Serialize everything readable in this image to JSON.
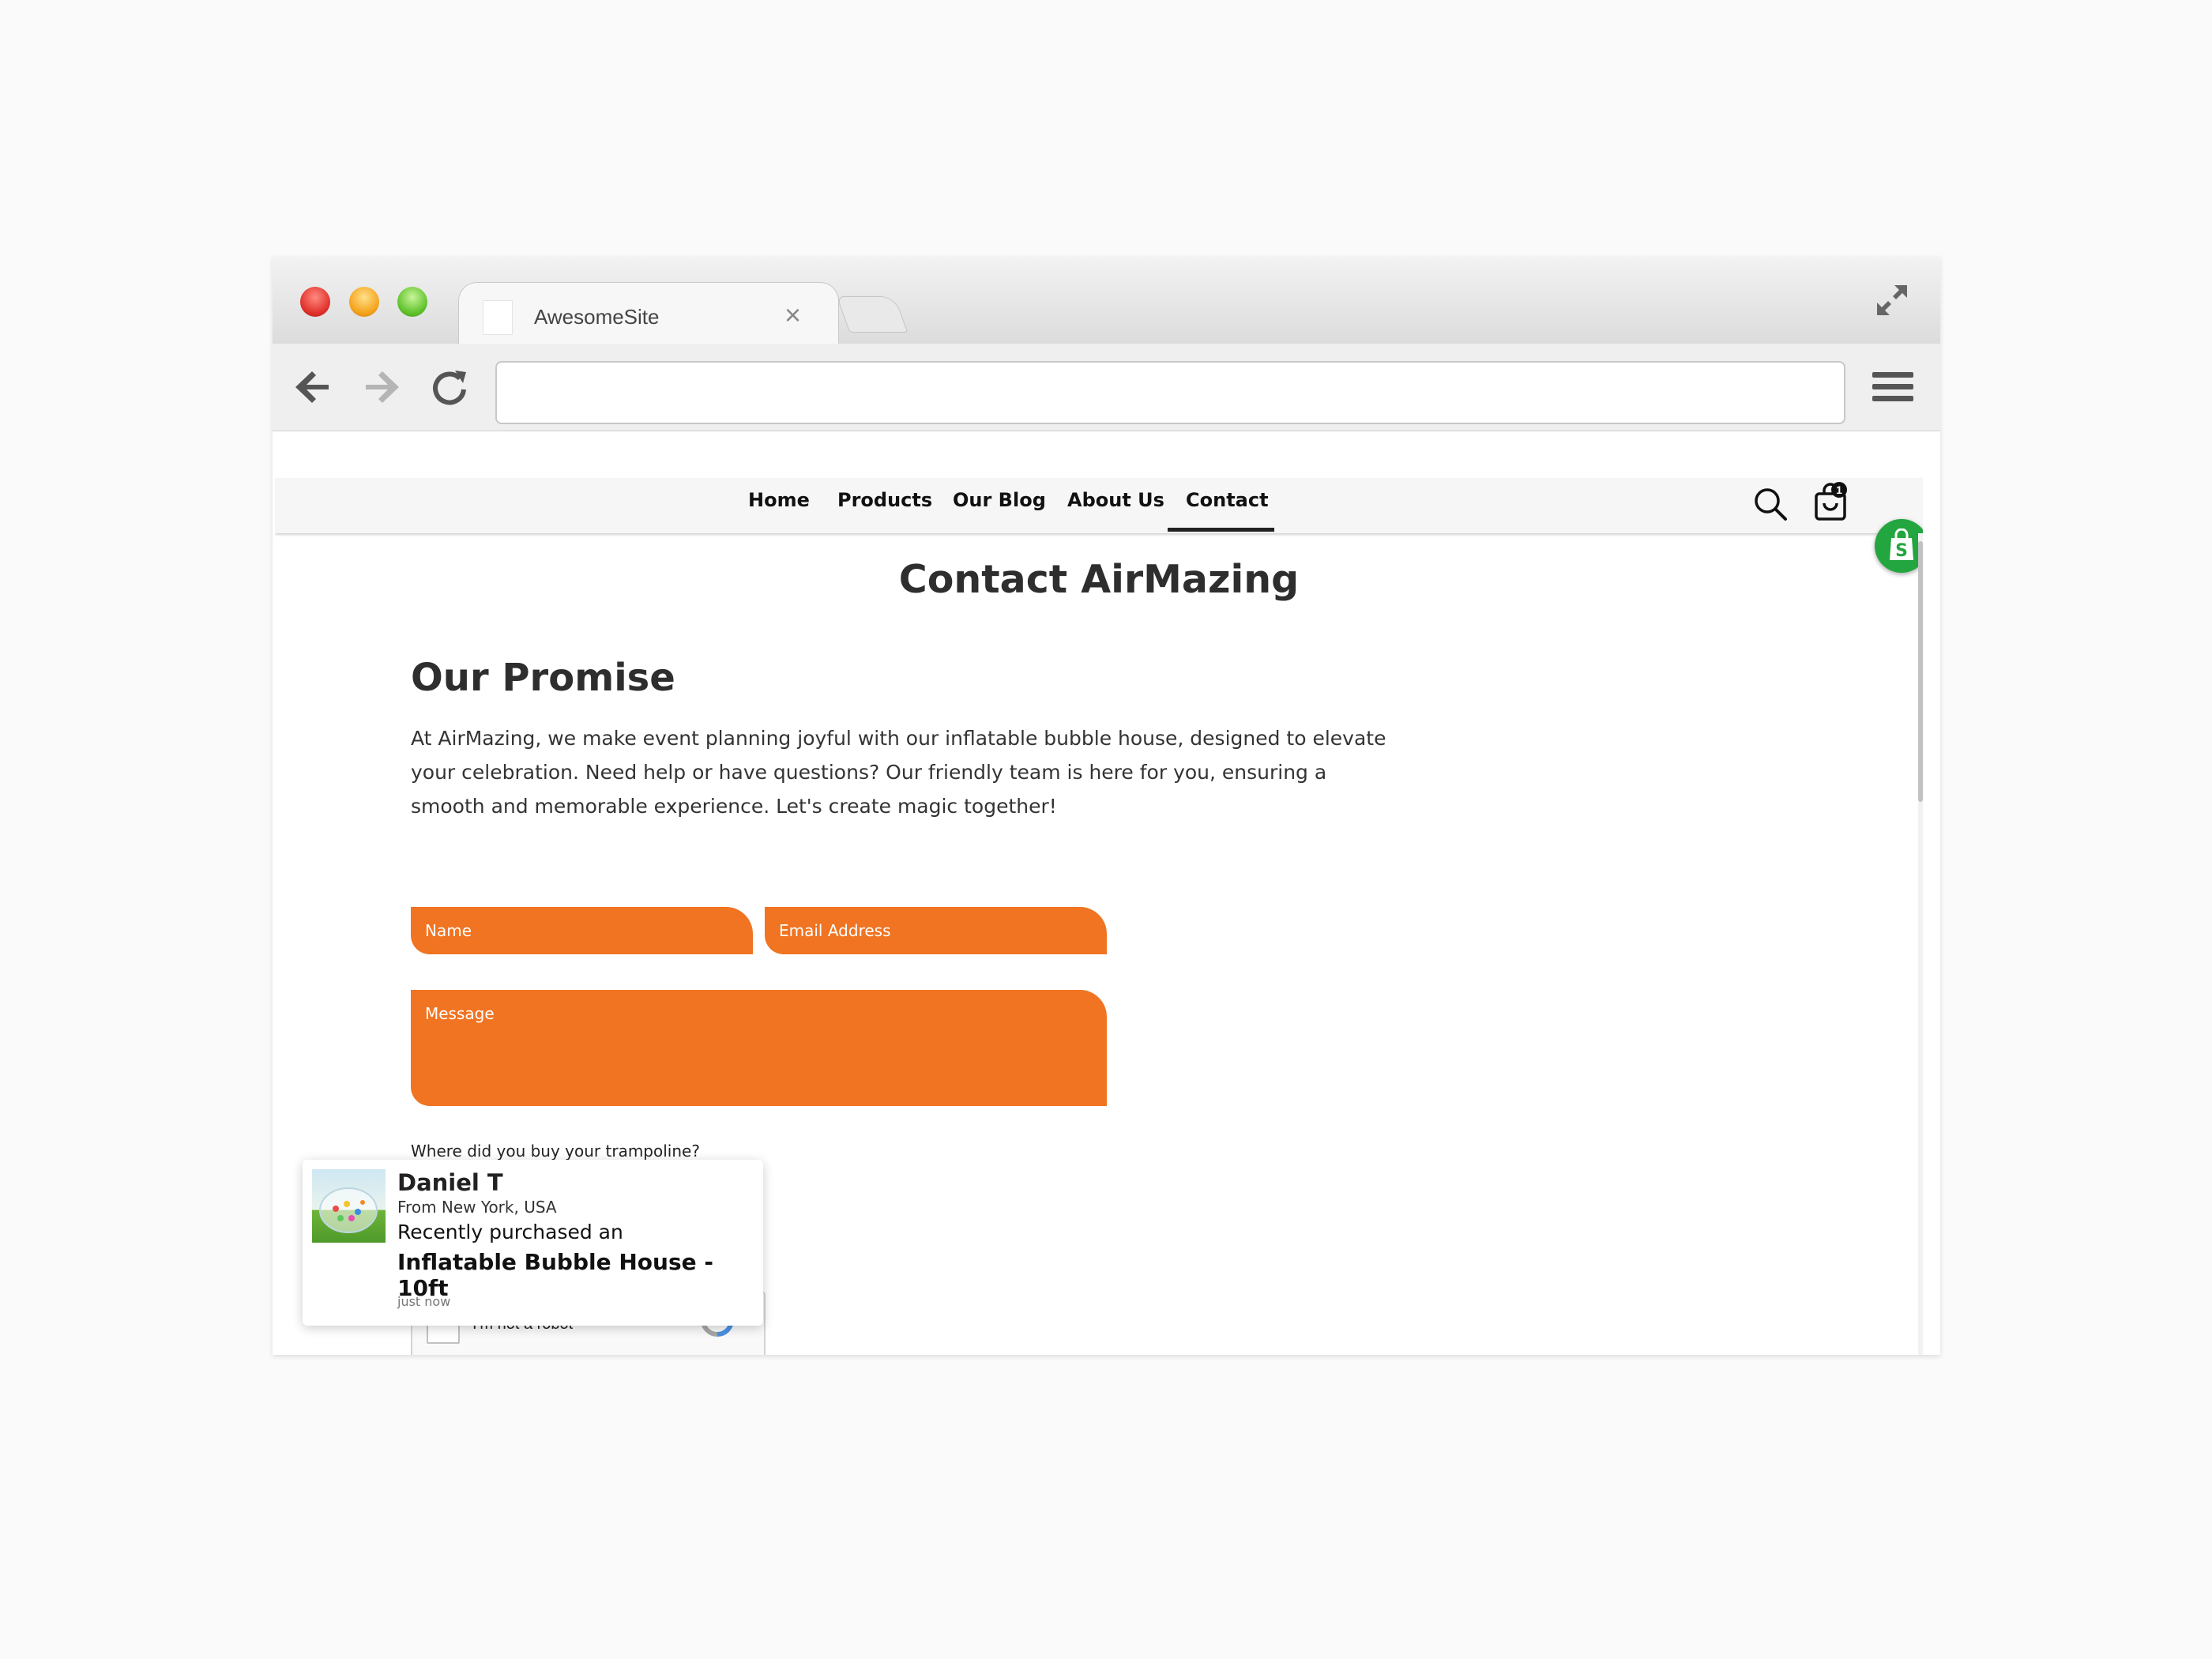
{
  "browser": {
    "tab_title": "AwesomeSite",
    "tab_close": "×",
    "address_value": ""
  },
  "site_nav": {
    "items": [
      {
        "label": "Home"
      },
      {
        "label": "Products"
      },
      {
        "label": "Our Blog"
      },
      {
        "label": "About Us"
      },
      {
        "label": "Contact"
      }
    ],
    "active": "Contact",
    "cart_count": "1"
  },
  "page": {
    "title": "Contact AirMazing",
    "section_title": "Our Promise",
    "promise_text": "At AirMazing, we make event planning joyful with our inflatable bubble house, designed to elevate your celebration. Need help or have questions? Our friendly team is here for you, ensuring a smooth and memorable experience. Let's create magic together!"
  },
  "form": {
    "name_placeholder": "Name",
    "email_placeholder": "Email Address",
    "message_placeholder": "Message",
    "question_label": "Where did you buy your trampoline?",
    "recaptcha_label": "I'm not a robot",
    "accent_color": "#f07422"
  },
  "notification": {
    "name": "Daniel T",
    "from": "From New York, USA",
    "recent": "Recently purchased an",
    "product": "Inflatable Bubble House - 10ft",
    "time": "just now"
  },
  "icons": [
    "expand-icon",
    "back-arrow-icon",
    "forward-arrow-icon",
    "reload-icon",
    "hamburger-menu-icon",
    "search-icon",
    "cart-icon",
    "shopify-icon",
    "recaptcha-icon"
  ]
}
